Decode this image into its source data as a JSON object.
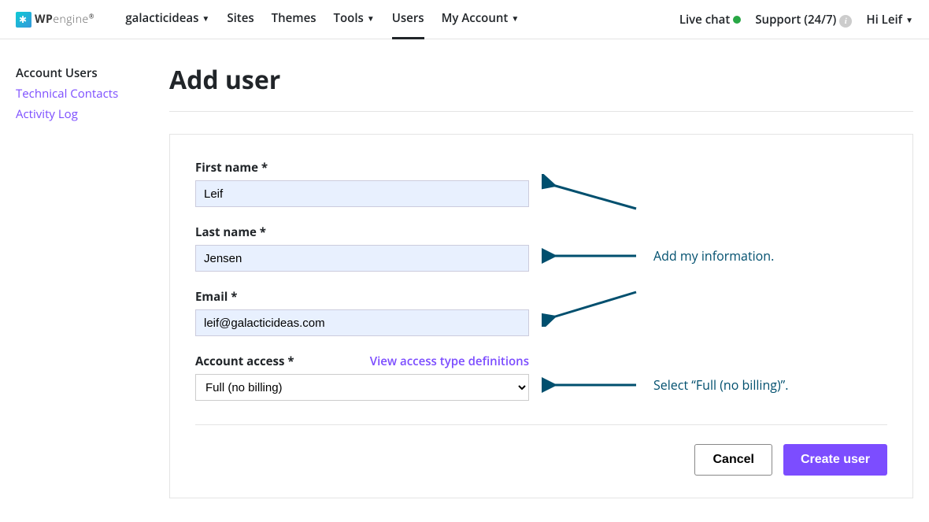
{
  "brand": {
    "wp": "WP",
    "engine": "engine",
    "r": "®"
  },
  "nav": {
    "account": "galacticideas",
    "items": [
      "Sites",
      "Themes",
      "Tools",
      "Users",
      "My Account"
    ]
  },
  "topright": {
    "chat": "Live chat",
    "support": "Support (24/7)",
    "greet": "Hi Leif"
  },
  "sidebar": {
    "items": [
      "Account Users",
      "Technical Contacts",
      "Activity Log"
    ]
  },
  "page": {
    "title": "Add user"
  },
  "form": {
    "first_name": {
      "label": "First name *",
      "value": "Leif"
    },
    "last_name": {
      "label": "Last name *",
      "value": "Jensen"
    },
    "email": {
      "label": "Email *",
      "value": "leif@galacticideas.com"
    },
    "access": {
      "label": "Account access *",
      "link": "View access type definitions",
      "value": "Full (no billing)"
    },
    "cancel": "Cancel",
    "submit": "Create user"
  },
  "annotations": {
    "info": "Add my information.",
    "access": "Select “Full (no billing)”."
  }
}
